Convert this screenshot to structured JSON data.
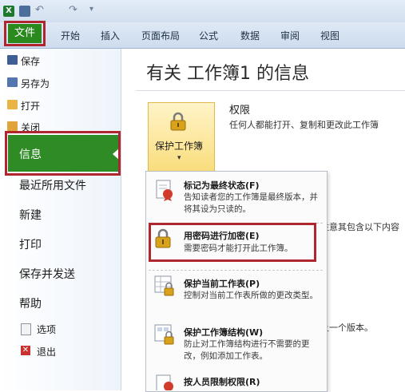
{
  "ribbon": {
    "file_tab": "文件",
    "tabs": [
      "开始",
      "插入",
      "页面布局",
      "公式",
      "数据",
      "审阅",
      "视图"
    ]
  },
  "nav": {
    "save": "保存",
    "save_as": "另存为",
    "open": "打开",
    "close": "关闭",
    "info": "信息",
    "recent": "最近所用文件",
    "new": "新建",
    "print": "打印",
    "save_send": "保存并发送",
    "help": "帮助",
    "options": "选项",
    "exit": "退出"
  },
  "main": {
    "title": "有关 工作簿1 的信息",
    "permissions_title": "权限",
    "permissions_desc": "任何人都能打开、复制和更改此工作簿",
    "protect_button": "保护工作簿",
    "protect_arrow": "▾",
    "bg_line1": "注意其包含以下内容",
    "bg_line2": "上一个版本。"
  },
  "dropdown": {
    "items": [
      {
        "title": "标记为最终状态(F)",
        "desc": "告知读者您的工作簿是最终版本，并将其设为只读的。"
      },
      {
        "title": "用密码进行加密(E)",
        "desc": "需要密码才能打开此工作簿。"
      },
      {
        "title": "保护当前工作表(P)",
        "desc": "控制对当前工作表所做的更改类型。"
      },
      {
        "title": "保护工作簿结构(W)",
        "desc": "防止对工作簿结构进行不需要的更改，例如添加工作表。"
      },
      {
        "title": "按人员限制权限(R)",
        "desc": ""
      }
    ]
  },
  "colors": {
    "accent_green": "#2e8b25",
    "highlight_red": "#b0262e",
    "ribbon_blue": "#dfe9f5"
  }
}
